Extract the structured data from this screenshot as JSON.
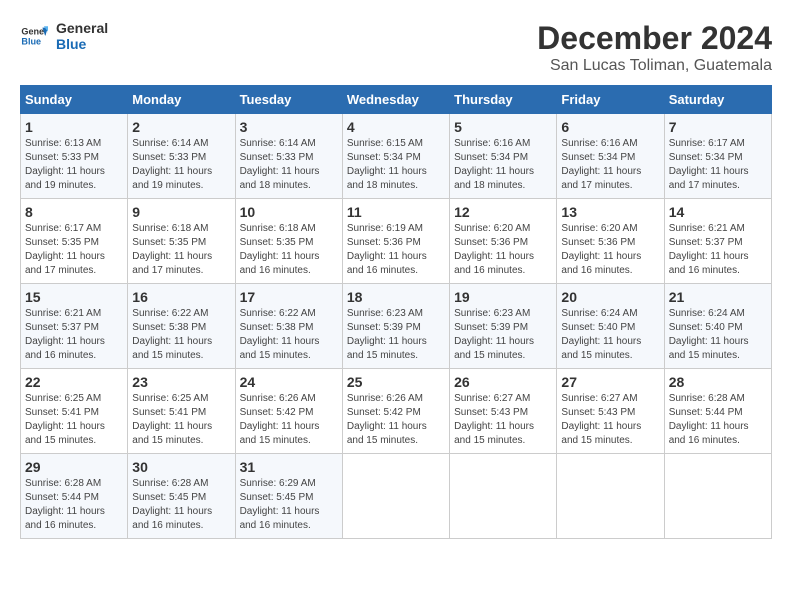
{
  "header": {
    "logo_line1": "General",
    "logo_line2": "Blue",
    "month": "December 2024",
    "location": "San Lucas Toliman, Guatemala"
  },
  "days_of_week": [
    "Sunday",
    "Monday",
    "Tuesday",
    "Wednesday",
    "Thursday",
    "Friday",
    "Saturday"
  ],
  "weeks": [
    [
      {
        "day": "1",
        "info": "Sunrise: 6:13 AM\nSunset: 5:33 PM\nDaylight: 11 hours\nand 19 minutes."
      },
      {
        "day": "2",
        "info": "Sunrise: 6:14 AM\nSunset: 5:33 PM\nDaylight: 11 hours\nand 19 minutes."
      },
      {
        "day": "3",
        "info": "Sunrise: 6:14 AM\nSunset: 5:33 PM\nDaylight: 11 hours\nand 18 minutes."
      },
      {
        "day": "4",
        "info": "Sunrise: 6:15 AM\nSunset: 5:34 PM\nDaylight: 11 hours\nand 18 minutes."
      },
      {
        "day": "5",
        "info": "Sunrise: 6:16 AM\nSunset: 5:34 PM\nDaylight: 11 hours\nand 18 minutes."
      },
      {
        "day": "6",
        "info": "Sunrise: 6:16 AM\nSunset: 5:34 PM\nDaylight: 11 hours\nand 17 minutes."
      },
      {
        "day": "7",
        "info": "Sunrise: 6:17 AM\nSunset: 5:34 PM\nDaylight: 11 hours\nand 17 minutes."
      }
    ],
    [
      {
        "day": "8",
        "info": "Sunrise: 6:17 AM\nSunset: 5:35 PM\nDaylight: 11 hours\nand 17 minutes."
      },
      {
        "day": "9",
        "info": "Sunrise: 6:18 AM\nSunset: 5:35 PM\nDaylight: 11 hours\nand 17 minutes."
      },
      {
        "day": "10",
        "info": "Sunrise: 6:18 AM\nSunset: 5:35 PM\nDaylight: 11 hours\nand 16 minutes."
      },
      {
        "day": "11",
        "info": "Sunrise: 6:19 AM\nSunset: 5:36 PM\nDaylight: 11 hours\nand 16 minutes."
      },
      {
        "day": "12",
        "info": "Sunrise: 6:20 AM\nSunset: 5:36 PM\nDaylight: 11 hours\nand 16 minutes."
      },
      {
        "day": "13",
        "info": "Sunrise: 6:20 AM\nSunset: 5:36 PM\nDaylight: 11 hours\nand 16 minutes."
      },
      {
        "day": "14",
        "info": "Sunrise: 6:21 AM\nSunset: 5:37 PM\nDaylight: 11 hours\nand 16 minutes."
      }
    ],
    [
      {
        "day": "15",
        "info": "Sunrise: 6:21 AM\nSunset: 5:37 PM\nDaylight: 11 hours\nand 16 minutes."
      },
      {
        "day": "16",
        "info": "Sunrise: 6:22 AM\nSunset: 5:38 PM\nDaylight: 11 hours\nand 15 minutes."
      },
      {
        "day": "17",
        "info": "Sunrise: 6:22 AM\nSunset: 5:38 PM\nDaylight: 11 hours\nand 15 minutes."
      },
      {
        "day": "18",
        "info": "Sunrise: 6:23 AM\nSunset: 5:39 PM\nDaylight: 11 hours\nand 15 minutes."
      },
      {
        "day": "19",
        "info": "Sunrise: 6:23 AM\nSunset: 5:39 PM\nDaylight: 11 hours\nand 15 minutes."
      },
      {
        "day": "20",
        "info": "Sunrise: 6:24 AM\nSunset: 5:40 PM\nDaylight: 11 hours\nand 15 minutes."
      },
      {
        "day": "21",
        "info": "Sunrise: 6:24 AM\nSunset: 5:40 PM\nDaylight: 11 hours\nand 15 minutes."
      }
    ],
    [
      {
        "day": "22",
        "info": "Sunrise: 6:25 AM\nSunset: 5:41 PM\nDaylight: 11 hours\nand 15 minutes."
      },
      {
        "day": "23",
        "info": "Sunrise: 6:25 AM\nSunset: 5:41 PM\nDaylight: 11 hours\nand 15 minutes."
      },
      {
        "day": "24",
        "info": "Sunrise: 6:26 AM\nSunset: 5:42 PM\nDaylight: 11 hours\nand 15 minutes."
      },
      {
        "day": "25",
        "info": "Sunrise: 6:26 AM\nSunset: 5:42 PM\nDaylight: 11 hours\nand 15 minutes."
      },
      {
        "day": "26",
        "info": "Sunrise: 6:27 AM\nSunset: 5:43 PM\nDaylight: 11 hours\nand 15 minutes."
      },
      {
        "day": "27",
        "info": "Sunrise: 6:27 AM\nSunset: 5:43 PM\nDaylight: 11 hours\nand 15 minutes."
      },
      {
        "day": "28",
        "info": "Sunrise: 6:28 AM\nSunset: 5:44 PM\nDaylight: 11 hours\nand 16 minutes."
      }
    ],
    [
      {
        "day": "29",
        "info": "Sunrise: 6:28 AM\nSunset: 5:44 PM\nDaylight: 11 hours\nand 16 minutes."
      },
      {
        "day": "30",
        "info": "Sunrise: 6:28 AM\nSunset: 5:45 PM\nDaylight: 11 hours\nand 16 minutes."
      },
      {
        "day": "31",
        "info": "Sunrise: 6:29 AM\nSunset: 5:45 PM\nDaylight: 11 hours\nand 16 minutes."
      },
      {
        "day": "",
        "info": ""
      },
      {
        "day": "",
        "info": ""
      },
      {
        "day": "",
        "info": ""
      },
      {
        "day": "",
        "info": ""
      }
    ]
  ]
}
